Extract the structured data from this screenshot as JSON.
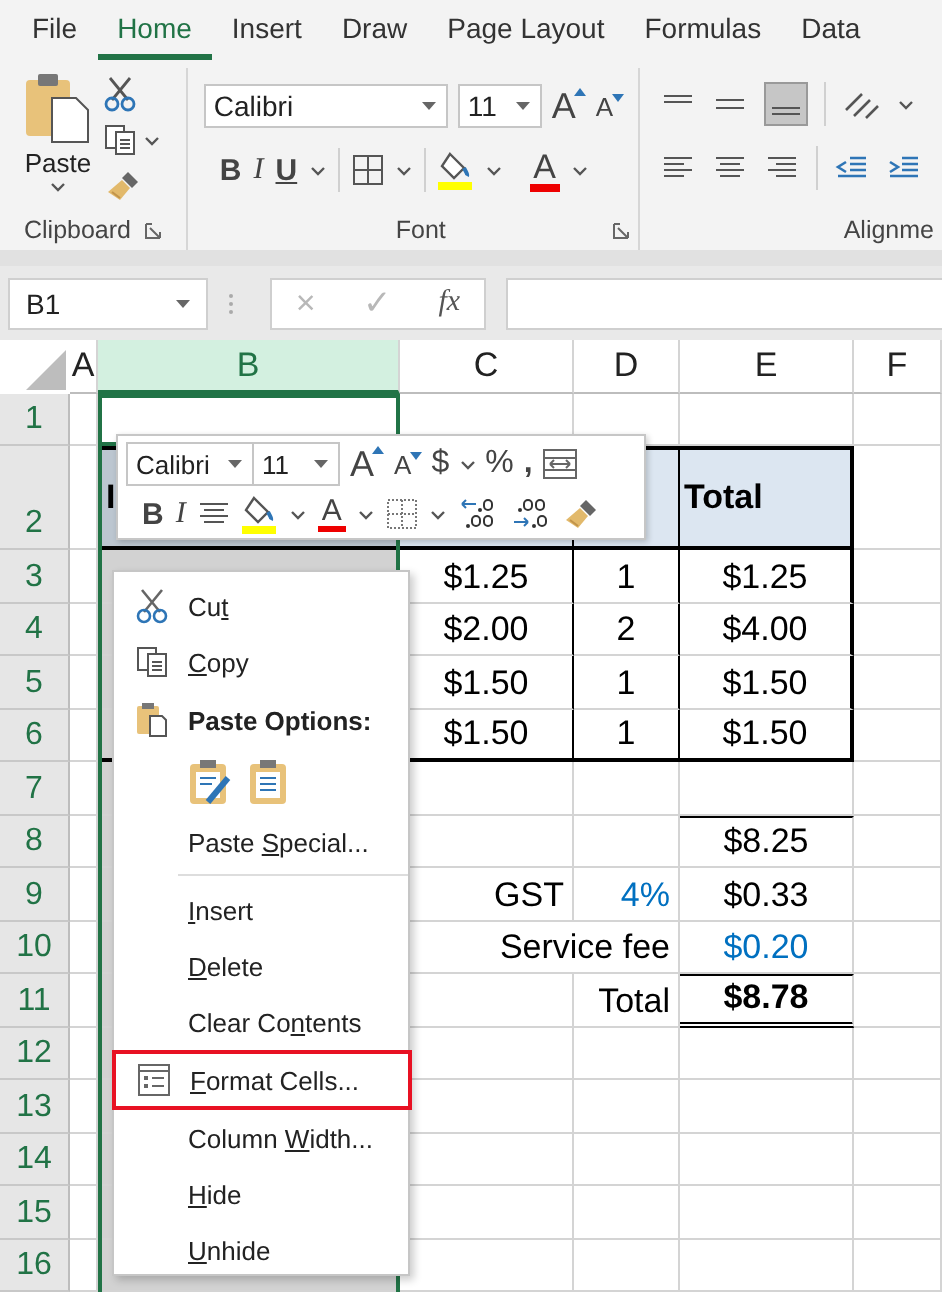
{
  "tabs": [
    {
      "label": "File",
      "selected": false
    },
    {
      "label": "Home",
      "selected": true
    },
    {
      "label": "Insert",
      "selected": false
    },
    {
      "label": "Draw",
      "selected": false
    },
    {
      "label": "Page Layout",
      "selected": false
    },
    {
      "label": "Formulas",
      "selected": false
    },
    {
      "label": "Data",
      "selected": false
    }
  ],
  "ribbon": {
    "clipboard": {
      "title": "Clipboard",
      "paste": "Paste"
    },
    "font": {
      "title": "Font",
      "font_name": "Calibri",
      "font_size": "11",
      "grow": "A",
      "shrink": "A",
      "bold": "B",
      "italic": "I",
      "underline": "U",
      "font_color": "A"
    },
    "alignment": {
      "title": "Alignme"
    }
  },
  "formula_bar": {
    "name_box": "B1",
    "cancel": {
      "glyph": "×",
      "disabled": true
    },
    "enter": {
      "glyph": "✓",
      "disabled": true
    },
    "function": "fx"
  },
  "sheet": {
    "columns": [
      {
        "label": "A",
        "selected": false
      },
      {
        "label": "B",
        "selected": true
      },
      {
        "label": "C",
        "selected": false
      },
      {
        "label": "D",
        "selected": false
      },
      {
        "label": "E",
        "selected": false
      },
      {
        "label": "F",
        "selected": false
      }
    ],
    "rows": [
      {
        "label": "1"
      },
      {
        "label": "2",
        "cells": {
          "B": {
            "text": "I",
            "kind": "header"
          },
          "E": {
            "text": "Total",
            "kind": "header"
          }
        }
      },
      {
        "label": "3",
        "cells": {
          "C": {
            "text": "$1.25",
            "kind": "number"
          },
          "D": {
            "text": "1",
            "kind": "number"
          },
          "E": {
            "text": "$1.25",
            "kind": "number"
          }
        }
      },
      {
        "label": "4",
        "cells": {
          "C": {
            "text": "$2.00",
            "kind": "number"
          },
          "D": {
            "text": "2",
            "kind": "number"
          },
          "E": {
            "text": "$4.00",
            "kind": "number"
          }
        }
      },
      {
        "label": "5",
        "cells": {
          "C": {
            "text": "$1.50",
            "kind": "number"
          },
          "D": {
            "text": "1",
            "kind": "number"
          },
          "E": {
            "text": "$1.50",
            "kind": "number"
          }
        }
      },
      {
        "label": "6",
        "cells": {
          "C": {
            "text": "$1.50",
            "kind": "number"
          },
          "D": {
            "text": "1",
            "kind": "number"
          },
          "E": {
            "text": "$1.50",
            "kind": "number"
          }
        }
      },
      {
        "label": "7"
      },
      {
        "label": "8",
        "cells": {
          "E": {
            "text": "$8.25",
            "kind": "number"
          }
        }
      },
      {
        "label": "9",
        "cells": {
          "C": {
            "text": "GST",
            "kind": "label"
          },
          "D": {
            "text": "4%",
            "kind": "rate"
          },
          "E": {
            "text": "$0.33",
            "kind": "number"
          }
        }
      },
      {
        "label": "10",
        "cells": {
          "C:D": {
            "text": "Service fee",
            "kind": "label"
          },
          "E": {
            "text": "$0.20",
            "kind": "fee"
          }
        }
      },
      {
        "label": "11",
        "cells": {
          "D": {
            "text": "Total",
            "kind": "label"
          },
          "E": {
            "text": "$8.78",
            "kind": "grand_total"
          }
        }
      },
      {
        "label": "12"
      },
      {
        "label": "13"
      },
      {
        "label": "14"
      },
      {
        "label": "15"
      },
      {
        "label": "16"
      }
    ]
  },
  "mini_toolbar": {
    "font_name": "Calibri",
    "font_size": "11",
    "grow": "A",
    "shrink": "A",
    "currency": "$",
    "percent": "%",
    "comma": ",",
    "bold": "B",
    "italic": "I",
    "font_color": "A"
  },
  "context_menu": {
    "items": [
      {
        "kind": "command",
        "pre": "Cu",
        "key": "t",
        "selected": false
      },
      {
        "kind": "command",
        "key": "C",
        "post": "opy",
        "selected": false
      },
      {
        "kind": "heading",
        "label": "Paste Options:"
      },
      {
        "kind": "paste_choices"
      },
      {
        "kind": "command",
        "pre": "Paste ",
        "key": "S",
        "post": "pecial...",
        "selected": false
      },
      {
        "kind": "separator"
      },
      {
        "kind": "command",
        "key": "I",
        "post": "nsert",
        "selected": false
      },
      {
        "kind": "command",
        "key": "D",
        "post": "elete",
        "selected": false
      },
      {
        "kind": "command",
        "pre": "Clear Co",
        "key": "n",
        "post": "tents",
        "selected": false
      },
      {
        "kind": "command",
        "key": "F",
        "post": "ormat Cells...",
        "selected": true
      },
      {
        "kind": "command",
        "pre": "Column ",
        "key": "W",
        "post": "idth...",
        "selected": false
      },
      {
        "kind": "command",
        "key": "H",
        "post": "ide",
        "selected": false
      },
      {
        "kind": "command",
        "key": "U",
        "post": "nhide",
        "selected": false
      }
    ]
  }
}
